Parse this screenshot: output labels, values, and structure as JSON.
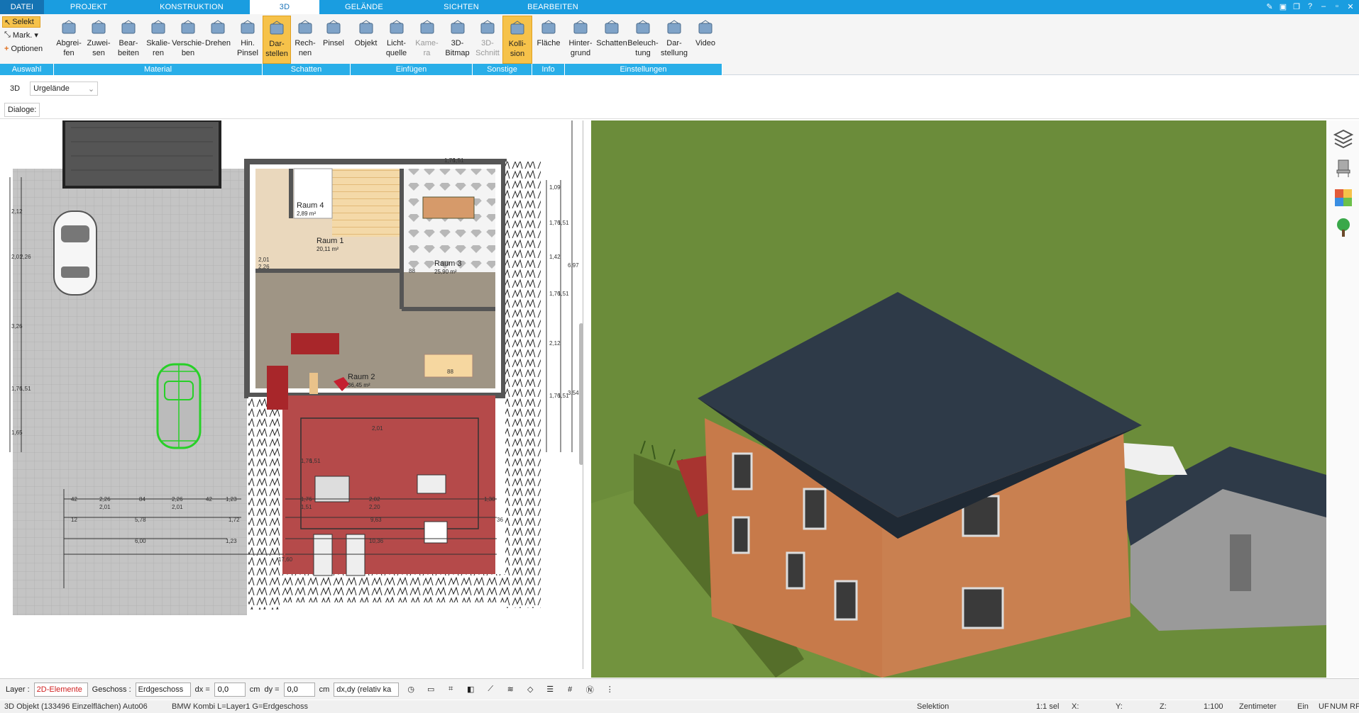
{
  "menu": {
    "tabs": [
      "DATEI",
      "PROJEKT",
      "KONSTRUKTION",
      "3D",
      "GELÄNDE",
      "SICHTEN",
      "BEARBEITEN"
    ],
    "active": "3D"
  },
  "ribbon": {
    "auswahl": {
      "selekt": "Selekt",
      "mark": "Mark.",
      "optionen": "Optionen",
      "label": "Auswahl"
    },
    "material": {
      "label": "Material",
      "buttons": [
        {
          "l1": "Abgrei-",
          "l2": "fen"
        },
        {
          "l1": "Zuwei-",
          "l2": "sen"
        },
        {
          "l1": "Bear-",
          "l2": "beiten"
        },
        {
          "l1": "Skalie-",
          "l2": "ren"
        },
        {
          "l1": "Verschie-",
          "l2": "ben"
        },
        {
          "l1": "Drehen",
          "l2": ""
        },
        {
          "l1": "Hin.",
          "l2": "Pinsel"
        }
      ]
    },
    "schatten": {
      "label": "Schatten",
      "buttons": [
        {
          "l1": "Dar-",
          "l2": "stellen"
        },
        {
          "l1": "Rech-",
          "l2": "nen"
        },
        {
          "l1": "Pinsel",
          "l2": ""
        }
      ]
    },
    "einfuegen": {
      "label": "Einfügen",
      "buttons": [
        {
          "l1": "Objekt",
          "l2": ""
        },
        {
          "l1": "Licht-",
          "l2": "quelle"
        },
        {
          "l1": "Kame-",
          "l2": "ra"
        },
        {
          "l1": "3D-",
          "l2": "Bitmap"
        }
      ]
    },
    "sonstige": {
      "label": "Sonstige",
      "buttons": [
        {
          "l1": "3D-",
          "l2": "Schnitt"
        },
        {
          "l1": "Kolli-",
          "l2": "sion"
        }
      ]
    },
    "info": {
      "label": "Info",
      "buttons": [
        {
          "l1": "Fläche",
          "l2": ""
        }
      ]
    },
    "einstellungen": {
      "label": "Einstellungen",
      "buttons": [
        {
          "l1": "Hinter-",
          "l2": "grund"
        },
        {
          "l1": "Schatten",
          "l2": ""
        },
        {
          "l1": "Beleuch-",
          "l2": "tung"
        },
        {
          "l1": "Dar-",
          "l2": "stellung"
        },
        {
          "l1": "Video",
          "l2": ""
        }
      ]
    }
  },
  "toolbar": {
    "mode": "3D",
    "terrain": "Urgelände",
    "dialoge": "Dialoge:"
  },
  "plan": {
    "rooms": [
      {
        "name": "Raum 4",
        "area": "2,89 m²"
      },
      {
        "name": "Raum 1",
        "area": "20,11 m²"
      },
      {
        "name": "Raum 3",
        "area": "25,90 m²"
      },
      {
        "name": "Raum 2",
        "area": "36,45 m²"
      }
    ],
    "dims": {
      "d1": "2,26",
      "d2": "2,01",
      "d3": "2,26",
      "d4": "2,01",
      "d5": "1,23",
      "d6": "5,78",
      "d7": "1,72",
      "d8": "6,00",
      "d9": "1,23",
      "d10": "1,76",
      "d11": "1,51",
      "d12": "2,02",
      "d13": "2,20",
      "d14": "1,30",
      "d15": "9,63",
      "d16": "10,36",
      "d17": "17,60",
      "d18": "42",
      "d19": "84",
      "d20": "42",
      "d21": "12",
      "d22": "36",
      "r1": "1,09",
      "r2": "1,76",
      "r3": "1,51",
      "r4": "1,42",
      "r5": "6,97",
      "r6": "1,76",
      "r7": "1,51",
      "r8": "2,12",
      "r9": "1,76",
      "r10": "1,51",
      "r11": "3,54",
      "l1": "2,12",
      "l2": "2,26",
      "l3": "2,01",
      "l4": "3,26",
      "l5": "1,76",
      "l6": "1,51",
      "l7": "1,65",
      "t1": "1,76",
      "t2": "1,51",
      "s1": "2,01",
      "s2": "2,26",
      "s3": "88",
      "s4": "1,76",
      "s5": "1,51",
      "s6": "2,01",
      "s7": "88"
    }
  },
  "bottom": {
    "layer_label": "Layer :",
    "layer_value": "2D-Elemente",
    "geschoss_label": "Geschoss :",
    "geschoss_value": "Erdgeschoss",
    "dx_label": "dx =",
    "dx_value": "0,0",
    "dy_label": "dy =",
    "dy_value": "0,0",
    "unit": "cm",
    "mode_value": "dx,dy (relativ ka"
  },
  "status": {
    "left": "3D Objekt (133496 Einzelflächen) Auto06",
    "info": "BMW Kombi L=Layer1 G=Erdgeschoss",
    "selektion": "Selektion",
    "sel": "1:1 sel",
    "x": "X:",
    "y": "Y:",
    "z": "Z:",
    "scale": "1:100",
    "unit": "Zentimeter",
    "ein": "Ein",
    "uf": "UF",
    "num": "NUM",
    "rf": "RF"
  },
  "colors": {
    "accent": "#1a9de0",
    "groupbar": "#29aee8",
    "active_btn": "#f6c24a",
    "grass": "#6b8c3a",
    "wall": "#c77a4a",
    "roof": "#2e3a48"
  }
}
